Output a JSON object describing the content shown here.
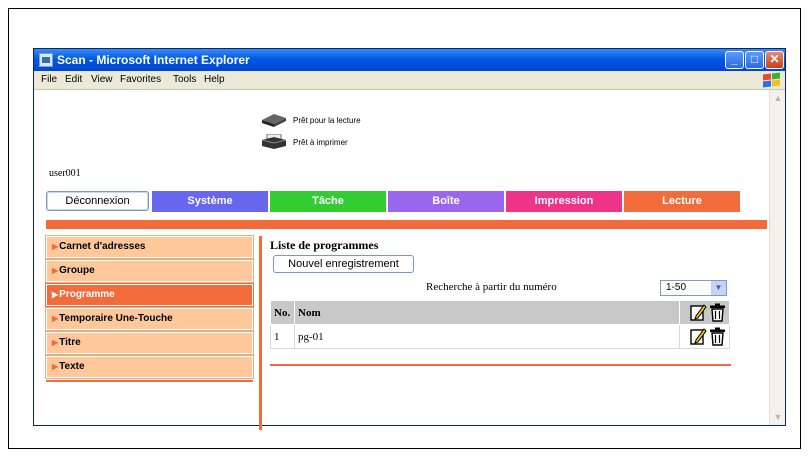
{
  "window": {
    "title": "Scan - Microsoft Internet Explorer",
    "menu": [
      "File",
      "Edit",
      "View",
      "Favorites",
      "Tools",
      "Help"
    ]
  },
  "status": {
    "scanner_text": "Prêt pour la lecture",
    "printer_text": "Prêt à imprimer"
  },
  "user": "user001",
  "logout_label": "Déconnexion",
  "tabs": [
    {
      "label": "Système",
      "color": "#6666ee"
    },
    {
      "label": "Tâche",
      "color": "#33cc33"
    },
    {
      "label": "Boîte",
      "color": "#9966ee"
    },
    {
      "label": "Impression",
      "color": "#ee3388"
    },
    {
      "label": "Lecture",
      "color": "#f26b3a"
    }
  ],
  "sidebar": {
    "items": [
      {
        "label": "Carnet d'adresses",
        "active": false
      },
      {
        "label": "Groupe",
        "active": false
      },
      {
        "label": "Programme",
        "active": true
      },
      {
        "label": "Temporaire Une-Touche",
        "active": false
      },
      {
        "label": "Titre",
        "active": false
      },
      {
        "label": "Texte",
        "active": false
      }
    ]
  },
  "main": {
    "title": "Liste de programmes",
    "new_button": "Nouvel enregistrement",
    "search_label": "Recherche à partir du numéro",
    "range_value": "1-50",
    "columns": {
      "no": "No.",
      "name": "Nom"
    },
    "rows": [
      {
        "no": "1",
        "name": "pg-01"
      }
    ]
  },
  "colors": {
    "accent": "#f26b3a",
    "sidebar_bg": "#ffc89a",
    "titlebar": "#0058e6"
  }
}
